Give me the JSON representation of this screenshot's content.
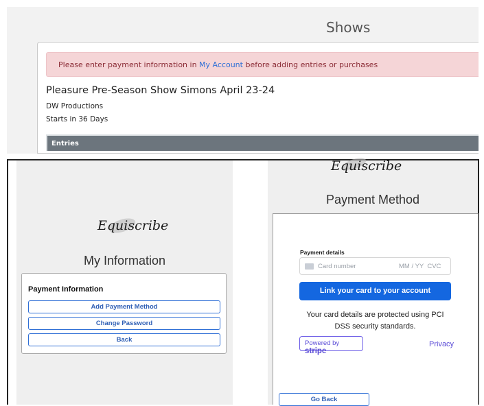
{
  "top": {
    "page_title": "Shows",
    "alert": {
      "before": "Please enter payment information in ",
      "link": "My Account",
      "after": " before adding entries or purchases"
    },
    "show_title": "Pleasure Pre-Season Show Simons April 23-24",
    "producer": "DW Productions",
    "starts": "Starts in 36 Days",
    "section_header": "Entries",
    "colors": {
      "alert_bg": "#f5d5d7",
      "alert_text": "#8b2c36",
      "link": "#2f6fd6",
      "header_bar": "#6c757d"
    }
  },
  "left_panel": {
    "logo": "Equiscribe",
    "heading": "My Information",
    "card_title": "Payment Information",
    "buttons": [
      "Add Payment Method",
      "Change Password",
      "Back"
    ]
  },
  "right_panel": {
    "logo": "Equiscribe",
    "heading": "Payment Method",
    "payment_details_label": "Payment details",
    "card_number_placeholder": "Card number",
    "expiry_cvc_placeholder": "MM / YY  CVC",
    "link_button": "Link your card to your account",
    "security_note": "Your card details are protected using PCI DSS security standards.",
    "powered_by": "Powered by",
    "stripe": "stripe",
    "privacy": "Privacy",
    "go_back": "Go Back",
    "colors": {
      "primary": "#1467e0",
      "stripe_purple": "#5a4bd6"
    }
  }
}
